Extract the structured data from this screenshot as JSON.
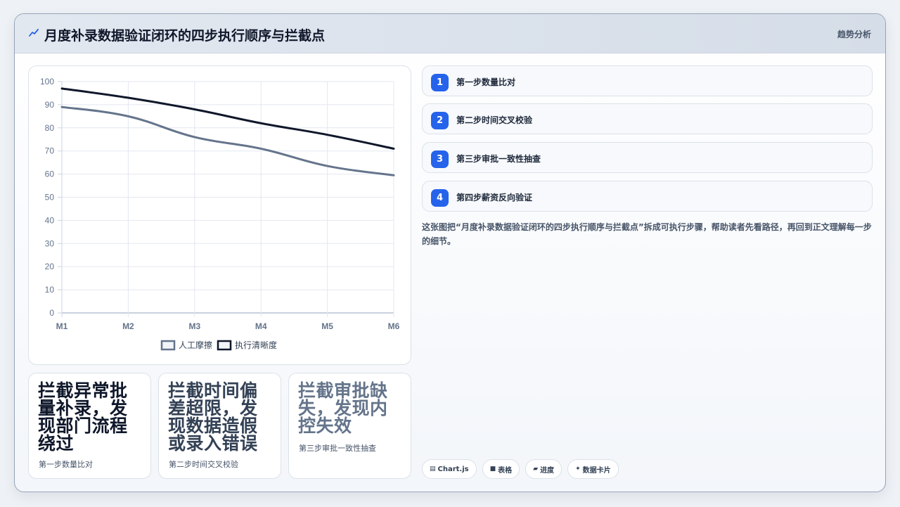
{
  "header": {
    "title": "月度补录数据验证闭环的四步执行顺序与拦截点",
    "tag": "趋势分析",
    "icon": "trend-icon"
  },
  "chart_data": {
    "type": "line",
    "categories": [
      "M1",
      "M2",
      "M3",
      "M4",
      "M5",
      "M6"
    ],
    "ylim": [
      0,
      100
    ],
    "yticks": [
      "0",
      "10",
      "20",
      "30",
      "40",
      "50",
      "60",
      "70",
      "80",
      "90",
      "100"
    ],
    "grid": true,
    "legend_position": "bottom",
    "series": [
      {
        "name": "人工摩擦",
        "values": [
          89,
          85,
          76,
          71,
          63.5,
          59.5
        ],
        "color": "#64748b"
      },
      {
        "name": "执行清晰度",
        "values": [
          97,
          93,
          88,
          82,
          77,
          71
        ],
        "color": "#0f172a"
      }
    ]
  },
  "highlights": [
    {
      "text": "拦截异常批量补录，发现部门流程绕过",
      "sub": "第一步数量比对",
      "color": "#0f172a"
    },
    {
      "text": "拦截时间偏差超限，发现数据造假或录入错误",
      "sub": "第二步时间交叉校验",
      "color": "#334155"
    },
    {
      "text": "拦截审批缺失，发现内控失效",
      "sub": "第三步审批一致性抽查",
      "color": "#64748b"
    }
  ],
  "steps": [
    {
      "num": "1",
      "label": "第一步数量比对"
    },
    {
      "num": "2",
      "label": "第二步时间交叉校验"
    },
    {
      "num": "3",
      "label": "第三步审批一致性抽查"
    },
    {
      "num": "4",
      "label": "第四步薪资反向验证"
    }
  ],
  "description": "这张图把“月度补录数据验证闭环的四步执行顺序与拦截点”拆成可执行步骤，帮助读者先看路径，再回到正文理解每一步的细节。",
  "chips": [
    {
      "icon": "chart-icon",
      "glyph": "▤",
      "label": "Chart.js"
    },
    {
      "icon": "table-icon",
      "glyph": "■",
      "label": "表格"
    },
    {
      "icon": "progress-icon",
      "glyph": "▰",
      "label": "进度"
    },
    {
      "icon": "sparkle-icon",
      "glyph": "✦",
      "label": "数据卡片"
    }
  ],
  "colors": {
    "accent": "#2563eb",
    "dark": "#0f172a",
    "muted": "#64748b"
  }
}
